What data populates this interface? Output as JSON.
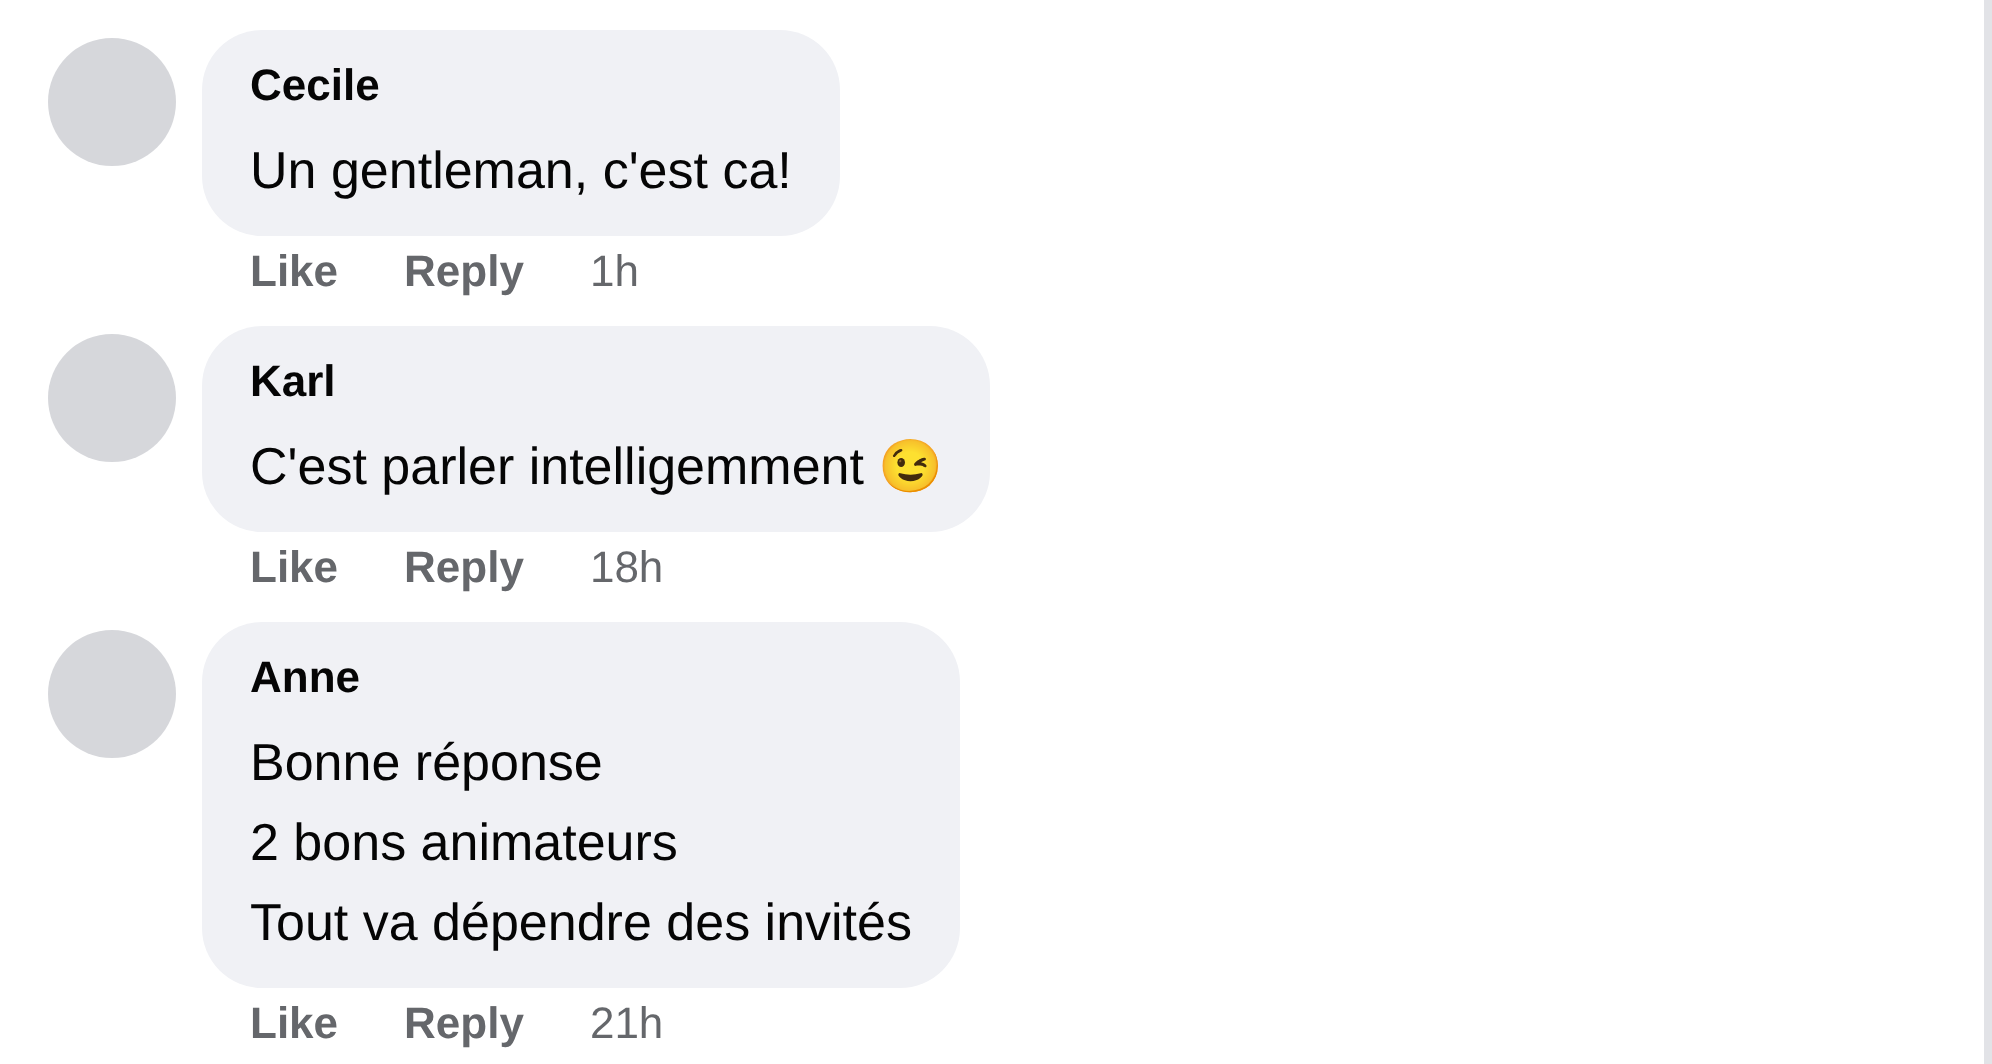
{
  "comments": [
    {
      "author": "Cecile",
      "lines": [
        "Un gentleman, c'est ca!"
      ],
      "actions": [
        "Like",
        "Reply"
      ],
      "time": "1h"
    },
    {
      "author": "Karl",
      "lines": [
        "C'est parler intelligemment 😉"
      ],
      "actions": [
        "Like",
        "Reply"
      ],
      "time": "18h"
    },
    {
      "author": "Anne",
      "lines": [
        "Bonne réponse",
        "2 bons animateurs",
        "Tout va dépendre des invités"
      ],
      "actions": [
        "Like",
        "Reply"
      ],
      "time": "21h"
    }
  ]
}
